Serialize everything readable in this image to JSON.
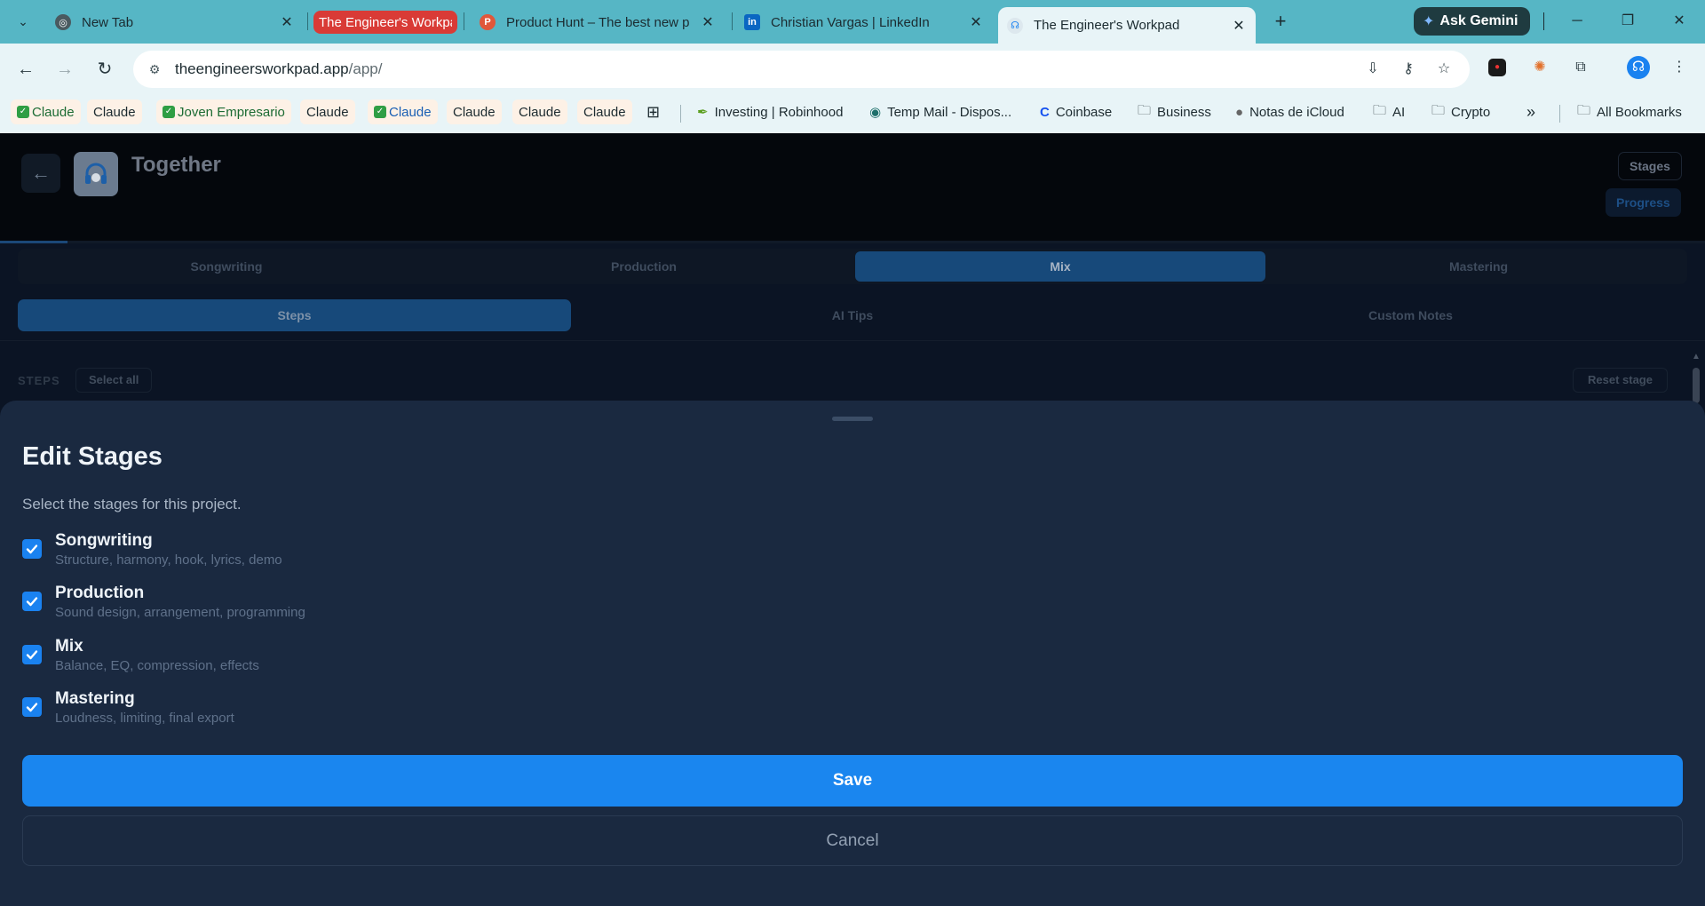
{
  "browser": {
    "tabs": [
      {
        "label": "New Tab",
        "icon": "chrome-icon"
      },
      {
        "label": "The Engineer's Workpad",
        "icon": "group-label"
      },
      {
        "label": "Product Hunt – The best new p",
        "icon": "product-hunt-icon"
      },
      {
        "label": "Christian Vargas | LinkedIn",
        "icon": "linkedin-icon"
      },
      {
        "label": "The Engineer's Workpad",
        "icon": "workpad-icon"
      }
    ],
    "gemini_label": "Ask Gemini",
    "url_host": "theengineersworkpad.app",
    "url_path": "/app/",
    "bookmarks": [
      "Claude",
      "Claude",
      "Joven Empresario",
      "Claude",
      "Claude",
      "Claude",
      "Claude",
      "Claude",
      "Investing | Robinhood",
      "Temp Mail - Dispos...",
      "Coinbase",
      "Business",
      "Notas de iCloud",
      "AI",
      "Crypto",
      "All Bookmarks"
    ],
    "colors": {
      "tabstrip": "#56b6c5",
      "toolbar": "#e8f4f7"
    }
  },
  "app": {
    "project_title": "Together",
    "stages_button": "Stages",
    "progress_button": "Progress",
    "stage_tabs": [
      "Songwriting",
      "Production",
      "Mix",
      "Mastering"
    ],
    "active_stage": "Mix",
    "view_tabs": [
      "Steps",
      "AI Tips",
      "Custom Notes"
    ],
    "active_view": "Steps",
    "steps_label": "STEPS",
    "select_all": "Select all",
    "reset_stage": "Reset stage"
  },
  "modal": {
    "title": "Edit Stages",
    "subtitle": "Select the stages for this project.",
    "stages": [
      {
        "name": "Songwriting",
        "description": "Structure, harmony, hook, lyrics, demo",
        "checked": true
      },
      {
        "name": "Production",
        "description": "Sound design, arrangement, programming",
        "checked": true
      },
      {
        "name": "Mix",
        "description": "Balance, EQ, compression, effects",
        "checked": true
      },
      {
        "name": "Mastering",
        "description": "Loudness, limiting, final export",
        "checked": true
      }
    ],
    "save_label": "Save",
    "cancel_label": "Cancel",
    "colors": {
      "accent": "#1a86ef",
      "sheet": "#1a2940"
    }
  }
}
